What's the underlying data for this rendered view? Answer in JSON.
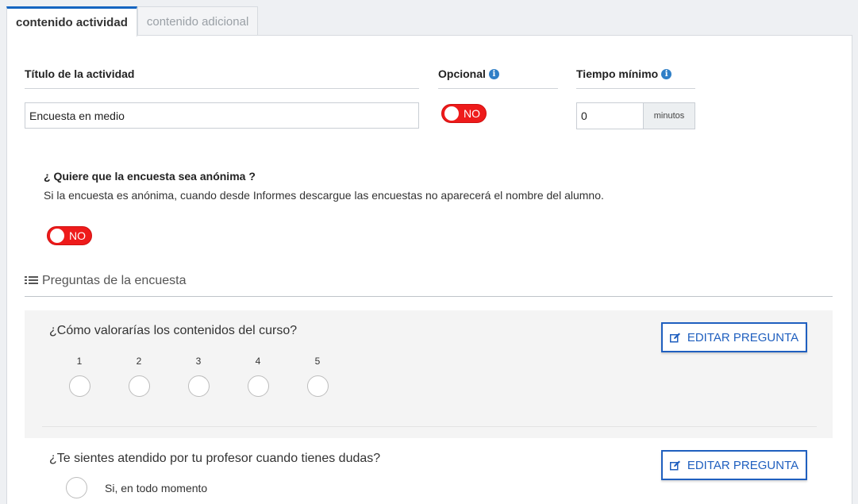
{
  "tabs": [
    {
      "label": "contenido actividad"
    },
    {
      "label": "contenido adicional"
    }
  ],
  "form": {
    "title_label": "Título de la actividad",
    "title_value": "Encuesta en medio",
    "optional_label": "Opcional",
    "optional_toggle": "NO",
    "min_time_label": "Tiempo mínimo",
    "min_time_value": "0",
    "min_time_unit": "minutos"
  },
  "anonymous": {
    "question": "¿ Quiere que la encuesta sea anónima ?",
    "description": "Si la encuesta es anónima, cuando desde Informes descargue las encuestas no aparecerá el nombre del alumno.",
    "toggle": "NO"
  },
  "survey": {
    "section_title": "Preguntas de la encuesta",
    "questions": [
      {
        "text": "¿Cómo valorarías los contenidos del curso?",
        "edit_label": "EDITAR PREGUNTA",
        "scale": [
          "1",
          "2",
          "3",
          "4",
          "5"
        ]
      },
      {
        "text": "¿Te sientes atendido por tu profesor cuando tienes dudas?",
        "edit_label": "EDITAR PREGUNTA",
        "options": [
          "Si, en todo momento"
        ]
      }
    ]
  },
  "icons": {
    "info": "info-icon",
    "list": "list-icon",
    "edit": "edit-icon"
  },
  "colors": {
    "accent": "#1f5fbf",
    "toggle_off": "#ee1b1b",
    "info": "#2f7fc7"
  }
}
